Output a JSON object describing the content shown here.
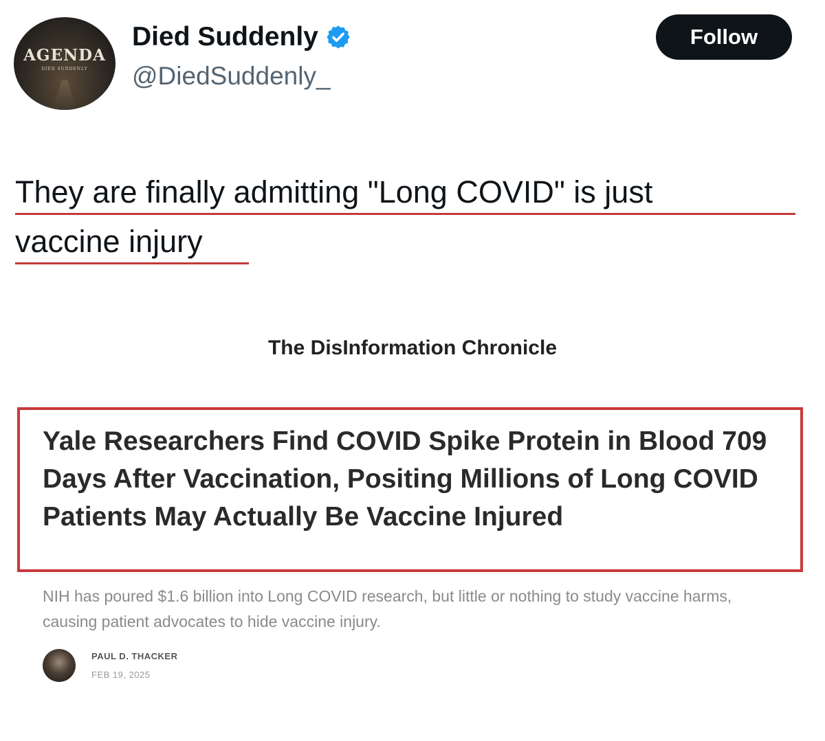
{
  "account": {
    "avatar_text": "AGENDA",
    "avatar_subtext": "DIED SUDDENLY",
    "name": "Died Suddenly",
    "handle": "@DiedSuddenly_",
    "follow_label": "Follow",
    "verified_color": "#1d9bf0"
  },
  "tweet": {
    "line1": "They are finally admitting \"Long COVID\" is just",
    "line2": "vaccine injury",
    "underline_color": "#c23a3a"
  },
  "article": {
    "publication": "The DisInformation Chronicle",
    "headline": "Yale Researchers Find COVID Spike Protein in Blood 709 Days After Vaccination, Positing Millions of Long COVID Patients May Actually Be Vaccine Injured",
    "summary": "NIH has poured $1.6 billion into Long COVID research, but little or nothing to study vaccine harms, causing patient advocates to hide vaccine injury.",
    "author": "PAUL D. THACKER",
    "date": "FEB 19, 2025",
    "highlight_color": "#c9393a"
  }
}
